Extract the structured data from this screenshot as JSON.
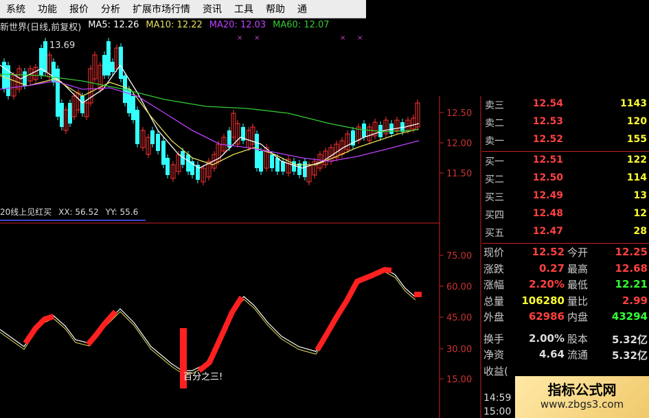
{
  "menu": [
    "系统",
    "功能",
    "报价",
    "分析",
    "扩展市场行情",
    "资讯",
    "工具",
    "帮助",
    "通"
  ],
  "chart_header": {
    "title": "新世界(日线,前复权)",
    "ma5": "MA5: 12.26",
    "ma10": "MA10: 12.22",
    "ma20": "MA20: 12.03",
    "ma60": "MA60: 12.07",
    "high_marker": "13.69"
  },
  "indicator": {
    "title": "20线上见红买",
    "xx": "XX: 56.52",
    "yy": "YY: 55.6",
    "annotation": "百分之三!"
  },
  "price_axis": [
    "12.50",
    "12.00",
    "11.50"
  ],
  "indicator_axis": [
    "75.00",
    "60.00",
    "45.00",
    "30.00",
    "15.00"
  ],
  "order_book": [
    {
      "label": "卖三",
      "price": "12.54",
      "vol": "1143"
    },
    {
      "label": "卖二",
      "price": "12.53",
      "vol": "120"
    },
    {
      "label": "卖一",
      "price": "12.52",
      "vol": "155"
    },
    {
      "label": "买一",
      "price": "12.51",
      "vol": "122"
    },
    {
      "label": "买二",
      "price": "12.50",
      "vol": "114"
    },
    {
      "label": "买三",
      "price": "12.49",
      "vol": "13"
    },
    {
      "label": "买四",
      "price": "12.48",
      "vol": "12"
    },
    {
      "label": "买五",
      "price": "12.47",
      "vol": "28"
    }
  ],
  "stats": [
    {
      "l": "现价",
      "v": "12.52",
      "vc": "#ff4040",
      "l2": "今开",
      "v2": "12.25",
      "v2c": "#ff4040"
    },
    {
      "l": "涨跌",
      "v": "0.27",
      "vc": "#ff4040",
      "l2": "最高",
      "v2": "12.68",
      "v2c": "#ff4040"
    },
    {
      "l": "涨幅",
      "v": "2.20%",
      "vc": "#ff4040",
      "l2": "最低",
      "v2": "12.21",
      "v2c": "#33ff33"
    },
    {
      "l": "总量",
      "v": "106280",
      "vc": "#ffff33",
      "l2": "量比",
      "v2": "2.99",
      "v2c": "#ff4040"
    },
    {
      "l": "外盘",
      "v": "62986",
      "vc": "#ff4040",
      "l2": "内盘",
      "v2": "43294",
      "v2c": "#33ff33"
    },
    {
      "l": "换手",
      "v": "2.00%",
      "vc": "#ddd",
      "l2": "股本",
      "v2": "5.32亿",
      "v2c": "#ddd"
    },
    {
      "l": "净资",
      "v": "4.64",
      "vc": "#ddd",
      "l2": "流通",
      "v2": "5.32亿",
      "v2c": "#ddd"
    },
    {
      "l": "收益(",
      "v": "",
      "vc": "#ddd",
      "l2": "",
      "v2": "",
      "v2c": "#ddd"
    }
  ],
  "time_lines": [
    "14:59",
    "15:00"
  ],
  "watermark": {
    "line1": "指标公式网",
    "line2": "www.zbgs3.com"
  },
  "colors": {
    "up": "#ff3333",
    "down": "#33ffff",
    "ma5": "#ffffff",
    "ma10": "#e8e05a",
    "ma20": "#c040ff",
    "ma60": "#33cc33",
    "axis": "#cc2222"
  }
}
